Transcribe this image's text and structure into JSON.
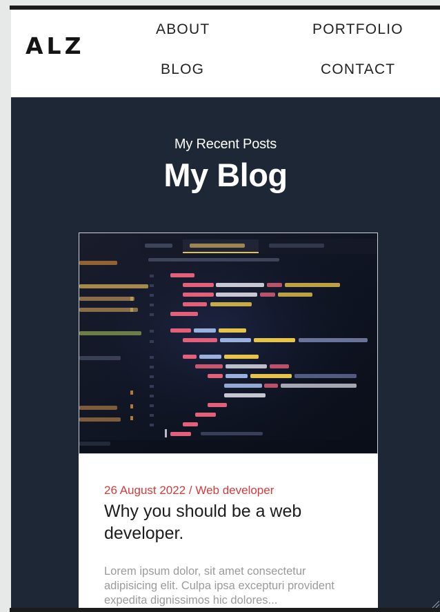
{
  "header": {
    "logo": "ALZ",
    "nav": {
      "about": "ABOUT",
      "portfolio": "PORTFOLIO",
      "blog": "BLOG",
      "contact": "CONTACT"
    }
  },
  "hero": {
    "subtitle": "My Recent Posts",
    "title": "My Blog"
  },
  "post": {
    "meta": "26 August 2022 / Web developer",
    "title": "Why you should be a web developer.",
    "excerpt": "Lorem ipsum dolor, sit amet consectetur adipisicing elit. Culpa ipsa excepturi provident expedita dignissimos hic dolores..."
  },
  "colors": {
    "page_background": "#1e2735",
    "header_background": "#ffffff",
    "accent_red": "#d63a3a",
    "excerpt_gray": "#9a9a9a"
  }
}
